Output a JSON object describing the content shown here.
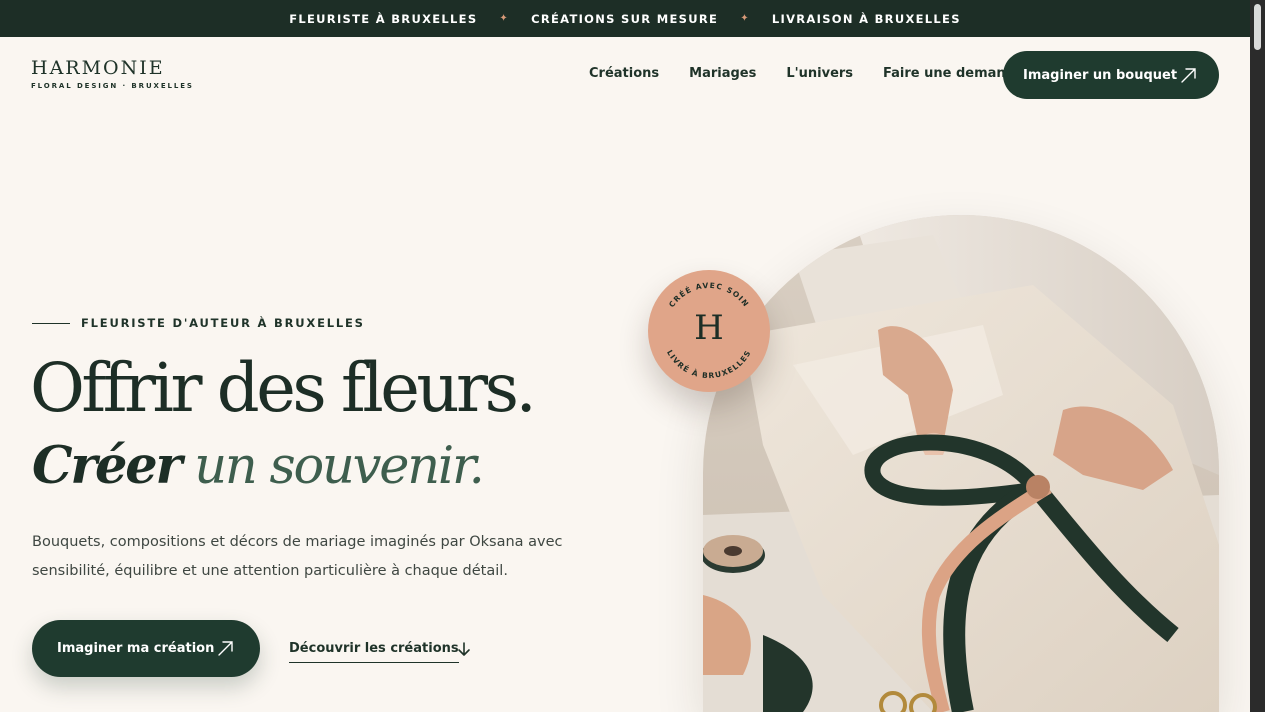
{
  "announcement": {
    "items": [
      "FLEURISTE À BRUXELLES",
      "CRÉATIONS SUR MESURE",
      "LIVRAISON À BRUXELLES"
    ],
    "separator": "✦"
  },
  "brand": {
    "name": "HARMONIE",
    "tagline": "FLORAL DESIGN · BRUXELLES"
  },
  "nav": {
    "items": [
      "Créations",
      "Mariages",
      "L'univers",
      "Faire une demande"
    ],
    "cta_label": "Imaginer un bouquet"
  },
  "hero": {
    "eyebrow": "FLEURISTE D'AUTEUR À BRUXELLES",
    "title": "Offrir des fleurs.",
    "subtitle_part1": "Créer",
    "subtitle_part2": " un souvenir.",
    "lead": "Bouquets, compositions et décors de mariage imaginés par Oksana avec sensibilité, équilibre et une attention particulière à chaque détail.",
    "primary_cta": "Imaginer ma création",
    "secondary_cta": "Découvrir les créations"
  },
  "badge": {
    "top_text": "CRÉÉ AVEC SOIN",
    "bottom_text": "LIVRÉ À BRUXELLES",
    "monogram": "H"
  },
  "colors": {
    "dark_green": "#1d2e26",
    "button_green": "#1f3b2f",
    "accent_peach": "#e0a589",
    "background": "#faf6f1"
  },
  "icons": {
    "cta_arrow": "arrow-up-right-icon",
    "secondary_arrow": "arrow-down-icon",
    "separator": "sparkle-icon"
  }
}
